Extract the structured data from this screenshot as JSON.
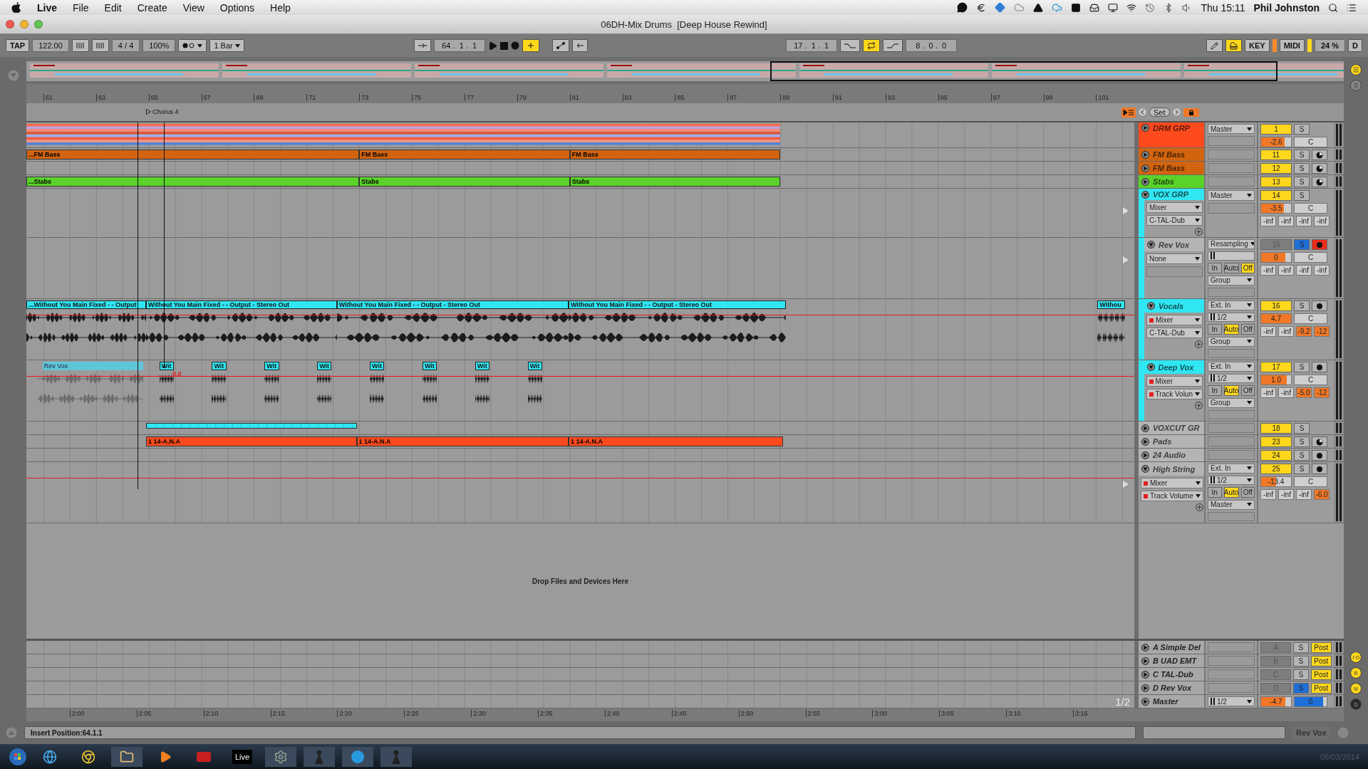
{
  "menu_bar": {
    "app": "Live",
    "items": [
      "File",
      "Edit",
      "Create",
      "View",
      "Options",
      "Help"
    ],
    "clock": "Thu 15:11",
    "user": "Phil Johnston"
  },
  "window": {
    "title": "06DH-Mix Drums  [Deep House Rewind]"
  },
  "control_bar": {
    "tap": "TAP",
    "tempo": "122.00",
    "signature": "4 / 4",
    "zoom": "100%",
    "quantize": "1 Bar",
    "position": "64 .  1 .  1",
    "overdub": true,
    "loop_start": "17 .  1 .  1",
    "loop_on": true,
    "loop_length": "8 .  0 .  0",
    "keys_on": true,
    "key": "KEY",
    "key_activity": true,
    "midi": "MIDI",
    "midi_activity": true,
    "cpu": "24 %",
    "disk": "D"
  },
  "ruler": {
    "bars": [
      "61",
      "63",
      "65",
      "67",
      "69",
      "71",
      "73",
      "75",
      "77",
      "79",
      "81",
      "83",
      "85",
      "87",
      "89",
      "91",
      "93",
      "95",
      "97",
      "99",
      "101"
    ],
    "locator": "Chorus 4",
    "set": "Set"
  },
  "tracks": [
    {
      "name": "DRM GRP",
      "color": "#ff4a1e",
      "kind": "group",
      "expanded": false,
      "output": "Master",
      "number": "1",
      "active": true,
      "volume": {
        "value": "-2.6",
        "level": 0.78
      },
      "pan": "C",
      "solo": "S",
      "solo_on": false,
      "clips": [
        {
          "kind": "stripes"
        }
      ]
    },
    {
      "name": "FM Bass",
      "color": "#d2640f",
      "kind": "midi",
      "expanded": false,
      "number": "11",
      "active": true,
      "solo": "S",
      "solo_on": false,
      "arm_on": false,
      "clips": [
        {
          "kind": "clip",
          "name": "...FM Bass"
        },
        {
          "kind": "clip",
          "name": "FM Bass"
        },
        {
          "kind": "clip",
          "name": "FM Bass"
        }
      ]
    },
    {
      "name": "FM Bass",
      "color": "#d2640f",
      "kind": "midi",
      "expanded": false,
      "number": "12",
      "active": true,
      "solo": "S",
      "solo_on": false,
      "arm_on": false
    },
    {
      "name": "Stabs",
      "color": "#5ad22a",
      "kind": "midi",
      "expanded": false,
      "number": "13",
      "active": true,
      "solo": "S",
      "solo_on": false,
      "arm_on": false,
      "clips": [
        {
          "kind": "clip",
          "name": "...Stabs"
        },
        {
          "kind": "clip",
          "name": "Stabs"
        },
        {
          "kind": "clip",
          "name": "Stabs"
        }
      ]
    },
    {
      "name": "VOX GRP",
      "color": "#30e6f2",
      "kind": "group",
      "expanded": true,
      "output": "Master",
      "number": "14",
      "active": true,
      "volume": {
        "value": "-3.5",
        "level": 0.75
      },
      "pan": "C",
      "solo": "S",
      "solo_on": false,
      "devices": [
        {
          "label": "Mixer",
          "automated": false
        },
        {
          "label": "C-TAL-Dub",
          "automated": false
        }
      ],
      "sends": [
        {
          "value": "-inf",
          "level": 0
        },
        {
          "value": "-inf",
          "level": 0
        },
        {
          "value": "-inf",
          "level": 0
        },
        {
          "value": "-inf",
          "level": 0
        }
      ],
      "children": [
        {
          "name": "Rev Vox",
          "color": "#b4b4b4",
          "kind": "audio",
          "expanded": true,
          "number": "15",
          "active": false,
          "input_type": "Resampling",
          "monitor": [
            {
              "label": "In",
              "selected": false
            },
            {
              "label": "Auto",
              "selected": false
            },
            {
              "label": "Off",
              "selected": true
            }
          ],
          "output": "Group",
          "volume": {
            "value": "0",
            "level": 0.82
          },
          "pan": "C",
          "solo": "S",
          "solo_on": true,
          "arm_on": true,
          "devices": [
            {
              "label": "None",
              "automated": false
            }
          ],
          "sends": [
            {
              "value": "-inf",
              "level": 0
            },
            {
              "value": "-inf",
              "level": 0
            },
            {
              "value": "-inf",
              "level": 0
            },
            {
              "value": "-inf",
              "level": 0
            }
          ]
        },
        {
          "name": "Vocals",
          "color": "#30e6f2",
          "kind": "audio",
          "expanded": true,
          "number": "16",
          "active": true,
          "input_type": "Ext. In",
          "input_channel": "1/2",
          "monitor": [
            {
              "label": "In",
              "selected": false
            },
            {
              "label": "Auto",
              "selected": true
            },
            {
              "label": "Off",
              "selected": false
            }
          ],
          "output": "Group",
          "volume": {
            "value": "4.7",
            "level": 1
          },
          "pan": "C",
          "solo": "S",
          "solo_on": false,
          "arm_on": false,
          "devices": [
            {
              "label": "Mixer",
              "automated": true
            },
            {
              "label": "C-TAL-Dub",
              "automated": false
            }
          ],
          "sends": [
            {
              "value": "-inf",
              "level": 0
            },
            {
              "value": "-inf",
              "level": 0
            },
            {
              "value": "-9.2",
              "level": 1
            },
            {
              "value": "-12",
              "level": 1
            }
          ],
          "automation_line": true,
          "clips": [
            {
              "kind": "audio",
              "name": "...Without You Main Fixed -  - Output"
            },
            {
              "kind": "audio",
              "name": "Without You Main Fixed -  - Output - Stereo Out"
            },
            {
              "kind": "audio",
              "name": "Without You Main Fixed -  - Output - Stereo Out"
            },
            {
              "kind": "audio",
              "name": "Without You Main Fixed -  - Output - Stereo Out"
            },
            {
              "kind": "audio",
              "name": "Withou"
            }
          ]
        },
        {
          "name": "Deep Vox",
          "color": "#30e6f2",
          "kind": "audio",
          "expanded": true,
          "number": "17",
          "active": true,
          "input_type": "Ext. In",
          "input_channel": "1/2",
          "monitor": [
            {
              "label": "In",
              "selected": false
            },
            {
              "label": "Auto",
              "selected": true
            },
            {
              "label": "Off",
              "selected": false
            }
          ],
          "output": "Group",
          "volume": {
            "value": "1.0",
            "level": 0.85
          },
          "pan": "C",
          "solo": "S",
          "solo_on": false,
          "arm_on": false,
          "devices": [
            {
              "label": "Mixer",
              "automated": true
            },
            {
              "label": "Track Volun",
              "automated": true
            }
          ],
          "sends": [
            {
              "value": "-inf",
              "level": 0
            },
            {
              "value": "-inf",
              "level": 0
            },
            {
              "value": "-5.0",
              "level": 1
            },
            {
              "value": "-12",
              "level": 1
            }
          ],
          "automation_line": true,
          "automation_value": "0.0",
          "clips": [
            {
              "kind": "faded",
              "name": "Rev Vox"
            },
            {
              "kind": "audio",
              "name": "Wit"
            },
            {
              "kind": "audio",
              "name": "Wit"
            },
            {
              "kind": "audio",
              "name": "Wit"
            },
            {
              "kind": "audio",
              "name": "Wit"
            },
            {
              "kind": "audio",
              "name": "Wit"
            },
            {
              "kind": "audio",
              "name": "Wit"
            },
            {
              "kind": "audio",
              "name": "Wit"
            },
            {
              "kind": "audio",
              "name": "Wit"
            }
          ]
        }
      ]
    },
    {
      "name": "VOXCUT GR",
      "color": "#b4b4b4",
      "kind": "group",
      "expanded": false,
      "number": "18",
      "active": true,
      "solo": "S",
      "solo_on": false,
      "clips": [
        {
          "kind": "bar",
          "color": "#30e6f2"
        }
      ]
    },
    {
      "name": "Pads",
      "color": "#b4b4b4",
      "kind": "midi",
      "expanded": false,
      "number": "23",
      "active": true,
      "solo": "S",
      "solo_on": false,
      "arm_on": false,
      "clips": [
        {
          "kind": "clip",
          "name": "1 14-A.N.A",
          "color": "#ff4a1e"
        },
        {
          "kind": "clip",
          "name": "1 14-A.N.A",
          "color": "#ff4a1e"
        },
        {
          "kind": "clip",
          "name": "1 14-A.N.A",
          "color": "#ff4a1e"
        }
      ]
    },
    {
      "name": "24 Audio",
      "color": "#b4b4b4",
      "kind": "audio",
      "expanded": false,
      "number": "24",
      "active": true,
      "solo": "S",
      "solo_on": false,
      "arm_on": false
    },
    {
      "name": "High String",
      "color": "#b4b4b4",
      "kind": "audio",
      "expanded": true,
      "number": "25",
      "active": true,
      "input_type": "Ext. In",
      "input_channel": "1/2",
      "monitor": [
        {
          "label": "In",
          "selected": false
        },
        {
          "label": "Auto",
          "selected": true
        },
        {
          "label": "Off",
          "selected": false
        }
      ],
      "output": "Master",
      "volume": {
        "value": "-13.4",
        "level": 0.5
      },
      "pan": "C",
      "solo": "S",
      "solo_on": false,
      "arm_on": false,
      "devices": [
        {
          "label": "Mixer",
          "automated": true
        },
        {
          "label": "Track Volume",
          "automated": true
        }
      ],
      "sends": [
        {
          "value": "-inf",
          "level": 0
        },
        {
          "value": "-inf",
          "level": 0
        },
        {
          "value": "-inf",
          "level": 0
        },
        {
          "value": "-6.0",
          "level": 1
        }
      ],
      "automation_line": true
    }
  ],
  "drop_hint": "Drop Files and Devices Here",
  "returns": [
    {
      "name": "A Simple Del",
      "letter": "A",
      "solo": "S",
      "solo_on": false,
      "post": "Post"
    },
    {
      "name": "B UAD EMT",
      "letter": "B",
      "solo": "S",
      "solo_on": false,
      "post": "Post"
    },
    {
      "name": "C TAL-Dub",
      "letter": "C",
      "solo": "S",
      "solo_on": false,
      "post": "Post"
    },
    {
      "name": "D Rev Vox",
      "letter": "D",
      "solo": "S",
      "solo_on": true,
      "post": "Post"
    }
  ],
  "master": {
    "name": "Master",
    "channel": "1/2",
    "volume": {
      "value": "-4.7",
      "level": 0.8
    },
    "cue": {
      "value": "0",
      "level": 0.88
    },
    "page": "1/2"
  },
  "time_ruler": [
    "2:00",
    "2:05",
    "2:10",
    "2:15",
    "2:20",
    "2:25",
    "2:30",
    "2:35",
    "2:40",
    "2:45",
    "2:50",
    "2:55",
    "3:00",
    "3:05",
    "3:10",
    "3:15"
  ],
  "side_toggles": [
    {
      "label": "I·O",
      "on": true
    },
    {
      "label": "R",
      "on": true
    },
    {
      "label": "M",
      "on": true
    },
    {
      "label": "D",
      "on": false
    }
  ],
  "status_bar": {
    "message": "Insert Position:64.1.1",
    "track": "Rev Vox"
  },
  "taskbar": {
    "live": "Live",
    "date": "06/03/2014"
  }
}
